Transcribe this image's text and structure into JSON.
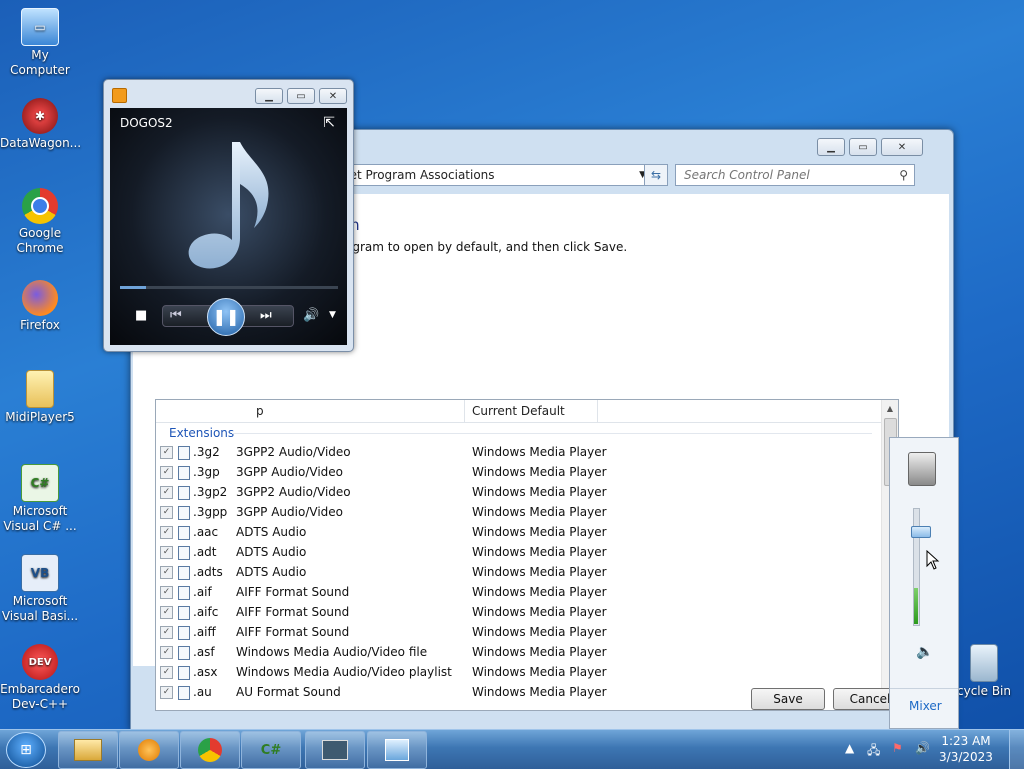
{
  "desktop_icons": [
    {
      "label": "My Computer",
      "icon": "computer-icon"
    },
    {
      "label": "DataWagon...",
      "icon": "datawagon-icon"
    },
    {
      "label": "Google Chrome",
      "icon": "chrome-icon"
    },
    {
      "label": "Firefox",
      "icon": "firefox-icon"
    },
    {
      "label": "MidiPlayer5",
      "icon": "folder-icon"
    },
    {
      "label": "Microsoft Visual C# ...",
      "icon": "visual-csharp-icon"
    },
    {
      "label": "Microsoft Visual Basi...",
      "icon": "visual-basic-icon"
    },
    {
      "label": "Embarcadero Dev-C++",
      "icon": "devcpp-icon"
    },
    {
      "label": "cycle Bin",
      "icon": "recycle-bin-icon"
    }
  ],
  "control_panel": {
    "breadcrumb": "Set Program Associations",
    "search_placeholder": "Search Control Panel",
    "heading": "m",
    "description": "ogram to open by default, and then click Save.",
    "columns": {
      "description": "p",
      "current_default": "Current Default"
    },
    "group_label": "Extensions",
    "rows": [
      {
        "ext": ".3g2",
        "desc": "3GPP2 Audio/Video",
        "default": "Windows Media Player"
      },
      {
        "ext": ".3gp",
        "desc": "3GPP Audio/Video",
        "default": "Windows Media Player"
      },
      {
        "ext": ".3gp2",
        "desc": "3GPP2 Audio/Video",
        "default": "Windows Media Player"
      },
      {
        "ext": ".3gpp",
        "desc": "3GPP Audio/Video",
        "default": "Windows Media Player"
      },
      {
        "ext": ".aac",
        "desc": "ADTS Audio",
        "default": "Windows Media Player"
      },
      {
        "ext": ".adt",
        "desc": "ADTS Audio",
        "default": "Windows Media Player"
      },
      {
        "ext": ".adts",
        "desc": "ADTS Audio",
        "default": "Windows Media Player"
      },
      {
        "ext": ".aif",
        "desc": "AIFF Format Sound",
        "default": "Windows Media Player"
      },
      {
        "ext": ".aifc",
        "desc": "AIFF Format Sound",
        "default": "Windows Media Player"
      },
      {
        "ext": ".aiff",
        "desc": "AIFF Format Sound",
        "default": "Windows Media Player"
      },
      {
        "ext": ".asf",
        "desc": "Windows Media Audio/Video file",
        "default": "Windows Media Player"
      },
      {
        "ext": ".asx",
        "desc": "Windows Media Audio/Video playlist",
        "default": "Windows Media Player"
      },
      {
        "ext": ".au",
        "desc": "AU Format Sound",
        "default": "Windows Media Player"
      }
    ],
    "save_label": "Save",
    "cancel_label": "Cancel"
  },
  "media_player": {
    "now_playing": "DOGOS2",
    "seek_fraction": 0.12
  },
  "volume_mixer": {
    "level_fraction": 0.8,
    "mixer_label": "Mixer"
  },
  "taskbar": {
    "time": "1:23 AM",
    "date": "3/3/2023",
    "apps": [
      "explorer-icon",
      "media-player-icon",
      "chrome-icon",
      "visual-csharp-icon",
      "remote-desktop-icon",
      "control-panel-icon"
    ]
  }
}
